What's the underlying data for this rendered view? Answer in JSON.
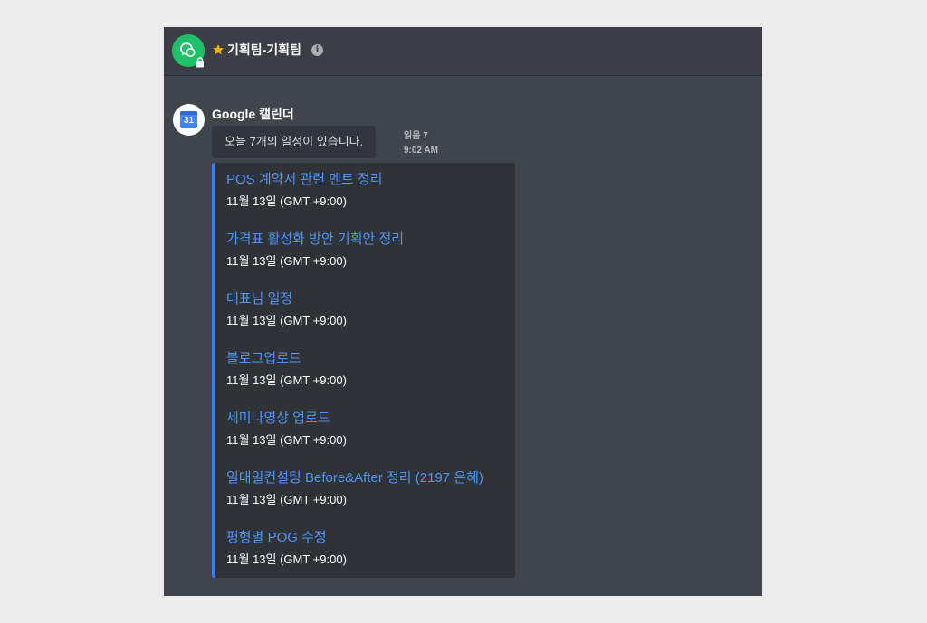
{
  "header": {
    "channel_name": "기획팀-기획팀"
  },
  "message": {
    "sender": "Google 캘린더",
    "calendar_icon_number": "31",
    "text": "오늘 7개의 일정이 있습니다.",
    "read_label": "읽음 7",
    "time": "9:02 AM"
  },
  "events": [
    {
      "title": "POS 계약서 관련 멘트 정리",
      "date": "11월 13일 (GMT +9:00)"
    },
    {
      "title": "가격표 활성화 방안 기획안 정리",
      "date": "11월 13일 (GMT +9:00)"
    },
    {
      "title": "대표님 일정",
      "date": "11월 13일 (GMT +9:00)"
    },
    {
      "title": "블로그업로드",
      "date": "11월 13일 (GMT +9:00)"
    },
    {
      "title": "세미나영상 업로드",
      "date": "11월 13일 (GMT +9:00)"
    },
    {
      "title": "일대일컨설팅 Before&After 정리 (2197 은혜)",
      "date": "11월 13일 (GMT +9:00)"
    },
    {
      "title": "평형별 POG 수정",
      "date": "11월 13일 (GMT +9:00)"
    }
  ],
  "colors": {
    "accent": "#3f7df2",
    "link": "#4e95f5",
    "channel_avatar": "#1ec06a",
    "star": "#f5b400"
  },
  "icons": {
    "channel": "chat-bubbles-icon",
    "lock": "lock-icon",
    "favorite": "star-icon",
    "info": "info-icon",
    "sender": "google-calendar-icon"
  }
}
